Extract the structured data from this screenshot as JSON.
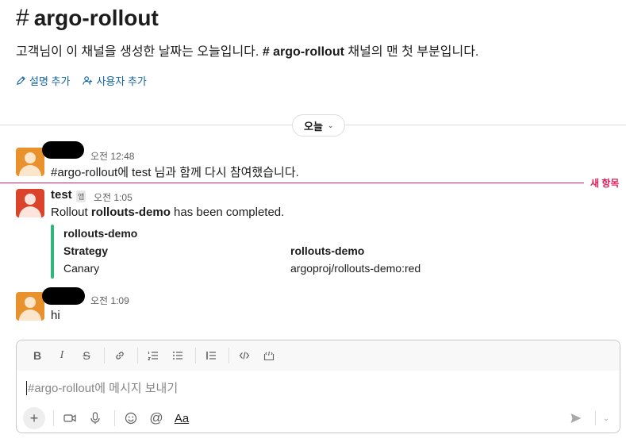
{
  "channel": {
    "hash": "#",
    "name": "argo-rollout",
    "intro_prefix": "고객님이 이 채널을 생성한 날짜는 오늘입니다.",
    "intro_channel": "# argo-rollout",
    "intro_suffix": "채널의 맨 첫 부분입니다.",
    "actions": {
      "add_description": "설명 추가",
      "add_people": "사용자 추가"
    }
  },
  "date_divider": {
    "label": "오늘"
  },
  "new_marker": {
    "label": "새 항목"
  },
  "messages": [
    {
      "time": "오전 12:48",
      "text": "#argo-rollout에 test 님과 함께 다시 참여했습니다."
    },
    {
      "sender": "test",
      "badge": "앱",
      "time": "오전 1:05",
      "text_prefix": "Rollout",
      "text_bold": "rollouts-demo",
      "text_suffix": "has been completed.",
      "attachment": {
        "title": "rollouts-demo",
        "fields": [
          {
            "title": "Strategy",
            "value": "Canary"
          },
          {
            "title": "rollouts-demo",
            "value": "argoproj/rollouts-demo:red"
          }
        ]
      }
    },
    {
      "time": "오전 1:09",
      "text": "hi"
    }
  ],
  "composer": {
    "placeholder": "#argo-rollout에 메시지 보내기",
    "toolbar": {
      "bold": "B",
      "italic": "I",
      "strike": "S"
    },
    "format_label": "Aa"
  },
  "colors": {
    "link": "#1264a3",
    "new_marker": "#e01e5a",
    "attachment_bar": "#2eb67d",
    "avatar_orange": "#e8912d",
    "avatar_red": "#d9442b"
  }
}
